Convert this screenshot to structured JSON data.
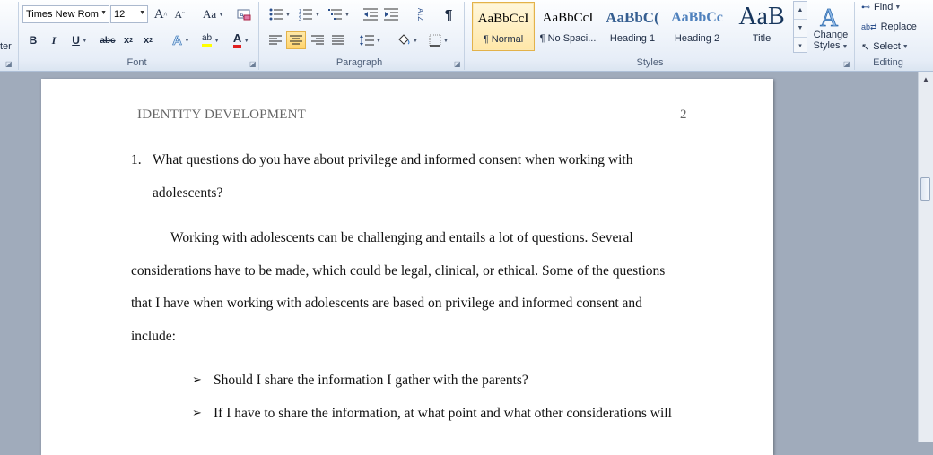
{
  "ribbon": {
    "clipboard_partial": "ter",
    "font": {
      "group_label": "Font",
      "font_name": "Times New Rom",
      "font_size": "12",
      "grow_label": "A",
      "shrink_label": "A",
      "change_case_label": "Aa",
      "bold": "B",
      "italic": "I",
      "underline": "U",
      "strikethrough": "abc",
      "subscript": "x",
      "superscript": "x",
      "text_effects": "A",
      "highlight": "ab",
      "font_color": "A"
    },
    "paragraph": {
      "group_label": "Paragraph",
      "show_marks": "¶",
      "sort": "A↓Z"
    },
    "styles": {
      "group_label": "Styles",
      "tiles": [
        {
          "sample": "AaBbCcI",
          "name": "¶ Normal"
        },
        {
          "sample": "AaBbCcI",
          "name": "¶ No Spaci..."
        },
        {
          "sample": "AaBbC(",
          "name": "Heading 1"
        },
        {
          "sample": "AaBbCc",
          "name": "Heading 2"
        },
        {
          "sample": "AaB",
          "name": "Title"
        }
      ],
      "change_styles_line1": "Change",
      "change_styles_line2": "Styles"
    },
    "editing": {
      "group_label": "Editing",
      "find": "Find",
      "replace": "Replace",
      "select": "Select"
    }
  },
  "document": {
    "header_title": "IDENTITY DEVELOPMENT",
    "page_number": "2",
    "question_number": "1.",
    "question_line1": "What questions do you have about privilege and informed consent when working with",
    "question_line2": "adolescents?",
    "para_line1": "Working with adolescents can be challenging and entails a lot of questions. Several",
    "para_line2": "considerations have to be made, which could be legal, clinical, or ethical. Some of the questions",
    "para_line3": "that I have when working with adolescents are based on privilege and informed consent and",
    "para_line4": "include:",
    "bullet_glyph": "➢",
    "bullet1": "Should I share the information I gather with the parents?",
    "bullet2": "If I have to share the information, at what point and what other considerations will"
  },
  "colors": {
    "ribbon_bg": "#e6edf7",
    "selected_style": "#ffe7a8",
    "heading_blue": "#365f91",
    "page_bg": "#ffffff",
    "workspace": "#a0abbb"
  }
}
